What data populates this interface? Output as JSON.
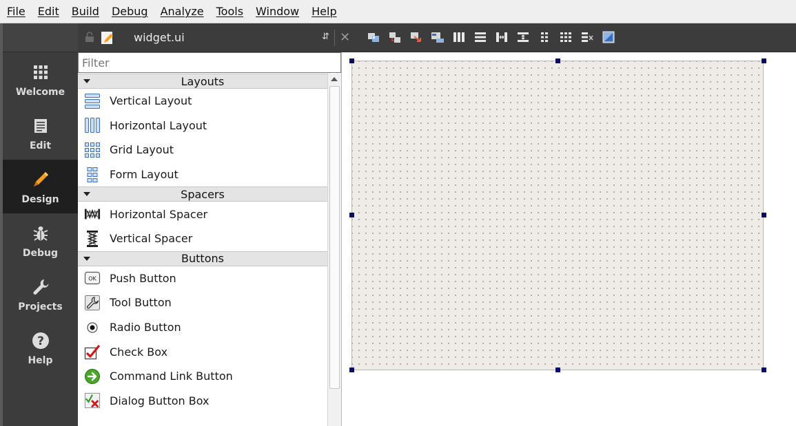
{
  "menubar": {
    "items": [
      "File",
      "Edit",
      "Build",
      "Debug",
      "Analyze",
      "Tools",
      "Window",
      "Help"
    ]
  },
  "modebar": {
    "modes": [
      {
        "label": "Welcome",
        "icon": "grid-icon"
      },
      {
        "label": "Edit",
        "icon": "document-icon"
      },
      {
        "label": "Design",
        "icon": "pencil-icon"
      },
      {
        "label": "Debug",
        "icon": "bug-icon"
      },
      {
        "label": "Projects",
        "icon": "wrench-icon"
      },
      {
        "label": "Help",
        "icon": "help-icon"
      }
    ],
    "active": "Design"
  },
  "toolbar": {
    "filename": "widget.ui",
    "icons": [
      "edit-widgets-icon",
      "edit-signals-slots-icon",
      "edit-buddies-icon",
      "edit-tab-order-icon",
      "layout-horizontal-icon",
      "layout-vertical-icon",
      "layout-horizontal-splitter-icon",
      "layout-vertical-splitter-icon",
      "layout-form-icon",
      "layout-grid-icon",
      "break-layout-icon",
      "adjust-size-icon"
    ]
  },
  "widgetbox": {
    "filter_placeholder": "Filter",
    "categories": [
      {
        "name": "Layouts",
        "items": [
          {
            "label": "Vertical Layout",
            "icon": "vertical-layout-icon"
          },
          {
            "label": "Horizontal Layout",
            "icon": "horizontal-layout-icon"
          },
          {
            "label": "Grid Layout",
            "icon": "grid-layout-icon"
          },
          {
            "label": "Form Layout",
            "icon": "form-layout-icon"
          }
        ]
      },
      {
        "name": "Spacers",
        "items": [
          {
            "label": "Horizontal Spacer",
            "icon": "horizontal-spacer-icon"
          },
          {
            "label": "Vertical Spacer",
            "icon": "vertical-spacer-icon"
          }
        ]
      },
      {
        "name": "Buttons",
        "items": [
          {
            "label": "Push Button",
            "icon": "push-button-icon"
          },
          {
            "label": "Tool Button",
            "icon": "tool-button-icon"
          },
          {
            "label": "Radio Button",
            "icon": "radio-button-icon"
          },
          {
            "label": "Check Box",
            "icon": "check-box-icon"
          },
          {
            "label": "Command Link Button",
            "icon": "command-link-icon"
          },
          {
            "label": "Dialog Button Box",
            "icon": "dialog-button-box-icon"
          }
        ]
      }
    ]
  },
  "colors": {
    "modebar_bg": "#3c3c3c",
    "active_mode_bg": "#1f1f1f",
    "form_bg": "#efebe6",
    "handle": "#0a0a6a",
    "pencil_orange": "#f5a020"
  }
}
